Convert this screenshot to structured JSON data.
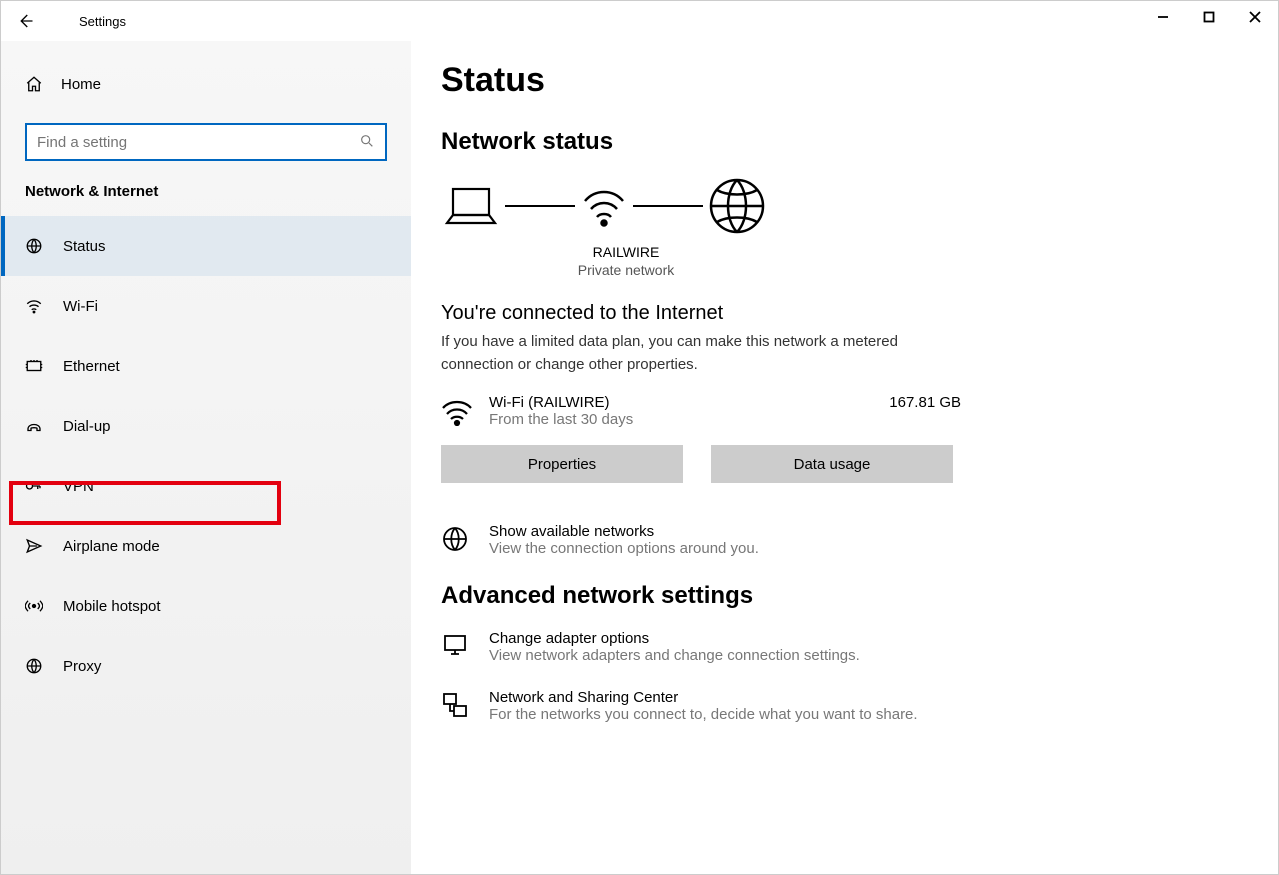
{
  "window": {
    "title": "Settings"
  },
  "sidebar": {
    "home": "Home",
    "search_placeholder": "Find a setting",
    "category": "Network & Internet",
    "items": [
      {
        "label": "Status"
      },
      {
        "label": "Wi-Fi"
      },
      {
        "label": "Ethernet"
      },
      {
        "label": "Dial-up"
      },
      {
        "label": "VPN"
      },
      {
        "label": "Airplane mode"
      },
      {
        "label": "Mobile hotspot"
      },
      {
        "label": "Proxy"
      }
    ]
  },
  "page": {
    "title": "Status",
    "network_status": "Network status",
    "diagram": {
      "name": "RAILWIRE",
      "type": "Private network"
    },
    "connected": {
      "title": "You're connected to the Internet",
      "desc": "If you have a limited data plan, you can make this network a metered connection or change other properties.",
      "wifi_name": "Wi-Fi (RAILWIRE)",
      "wifi_sub": "From the last 30 days",
      "wifi_usage": "167.81 GB",
      "properties_btn": "Properties",
      "data_usage_btn": "Data usage"
    },
    "available": {
      "title": "Show available networks",
      "desc": "View the connection options around you."
    },
    "advanced": {
      "title": "Advanced network settings",
      "adapter": {
        "title": "Change adapter options",
        "desc": "View network adapters and change connection settings."
      },
      "sharing": {
        "title": "Network and Sharing Center",
        "desc": "For the networks you connect to, decide what you want to share."
      }
    }
  }
}
